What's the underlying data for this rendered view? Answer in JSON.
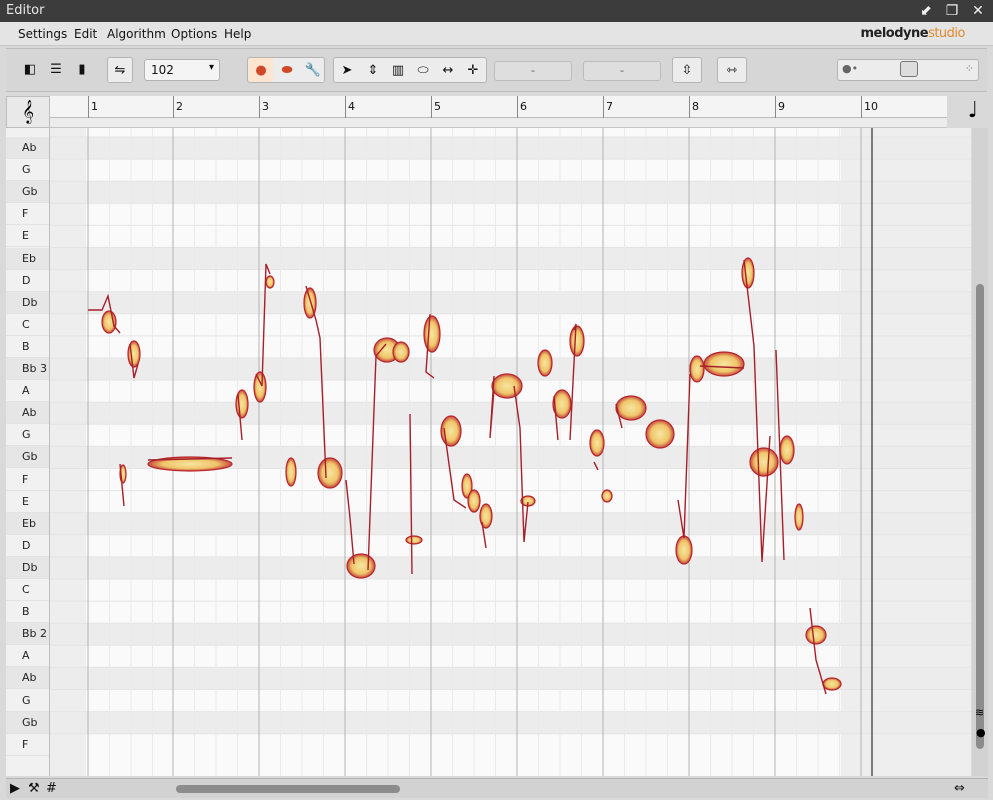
{
  "window": {
    "title": "Editor"
  },
  "menu": {
    "items": [
      "Settings",
      "Edit",
      "Algorithm",
      "Options",
      "Help"
    ]
  },
  "brand": {
    "name": "melodyne",
    "edition": "studio"
  },
  "toolbar": {
    "tempo_value": "102",
    "field_a": "-",
    "field_b": "-"
  },
  "ruler": {
    "bars": [
      "1",
      "2",
      "3",
      "4",
      "5",
      "6",
      "7",
      "8",
      "9",
      "10"
    ]
  },
  "pitch_keys": [
    "Ab",
    "G",
    "Gb",
    "F",
    "E",
    "Eb",
    "D",
    "Db",
    "C",
    "B",
    "Bb 3",
    "A",
    "Ab",
    "G",
    "Gb",
    "F",
    "E",
    "Eb",
    "D",
    "Db",
    "C",
    "B",
    "Bb 2",
    "A",
    "Ab",
    "G",
    "Gb",
    "F"
  ],
  "colors": {
    "blob_outer": "#b8242d",
    "blob_inner": "#f5e6a2",
    "line": "#a6202a"
  }
}
